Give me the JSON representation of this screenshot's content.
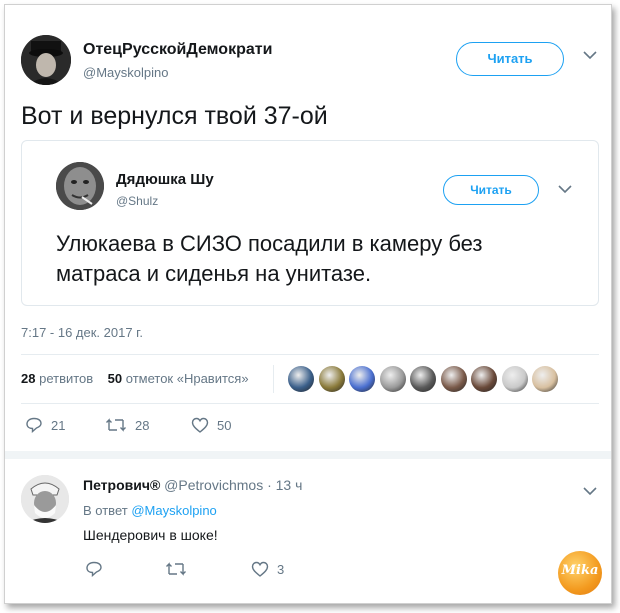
{
  "tweet": {
    "author_name": "ОтецРусскойДемократи",
    "author_handle": "@Mayskolpino",
    "follow_label": "Читать",
    "text": "Вот и вернулся твой 37-ой",
    "timestamp": "7:17 - 16 дек. 2017 г.",
    "retweets_count": "28",
    "retweets_label": "ретвитов",
    "likes_count": "50",
    "likes_label": "отметок «Нравится»",
    "actions": {
      "replies": "21",
      "retweets": "28",
      "likes": "50"
    }
  },
  "quoted": {
    "author_name": "Дядюшка Шу",
    "author_handle": "@Shulz",
    "follow_label": "Читать",
    "text_line1": "Улюкаева в СИЗО посадили в камеру без",
    "text_line2": "матраса и сиденья на унитазе."
  },
  "likers": [
    "#3a5f8a",
    "#8a7a3a",
    "#4a6fd0",
    "#9a9a9a",
    "#5a5a5a",
    "#7a5a4a",
    "#6a4a3a",
    "#c9c9c9",
    "#d8c0a0"
  ],
  "reply": {
    "author_name": "Петрович®",
    "author_handle": "@Petrovichmos",
    "time": "· 13 ч",
    "in_reply_prefix": "В ответ",
    "in_reply_handle": "@Mayskolpino",
    "text": "Шендерович в шоке!",
    "actions": {
      "replies": "",
      "retweets": "",
      "likes": "3"
    }
  },
  "watermark": "Mika",
  "colors": {
    "accent": "#1da1f2",
    "secondary_text": "#657786",
    "border": "#e1e8ed"
  }
}
